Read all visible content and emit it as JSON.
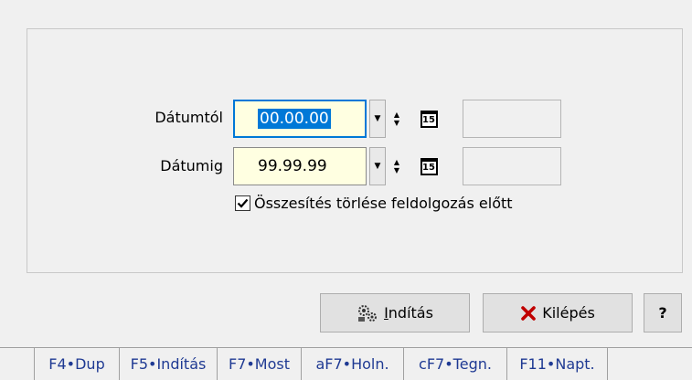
{
  "form": {
    "date_from": {
      "label": "Dátumtól",
      "value": "00.00.00",
      "extra": ""
    },
    "date_to": {
      "label": "Dátumig",
      "value": "99.99.99",
      "extra": ""
    },
    "calendar_icon_text": "15",
    "checkbox": {
      "label": "Összesítés törlése feldolgozás előtt",
      "checked": true
    }
  },
  "buttons": {
    "start_prefix": "",
    "start_underline": "I",
    "start_rest": "ndítás",
    "exit_label": "Kilépés",
    "help_label": "?"
  },
  "function_keys": [
    {
      "label": "F4•Dup"
    },
    {
      "label": "F5•Indítás"
    },
    {
      "label": "F7•Most"
    },
    {
      "label": "aF7•Holn."
    },
    {
      "label": "cF7•Tegn."
    },
    {
      "label": "F11•Napt."
    }
  ],
  "colors": {
    "input_bg": "#ffffe1",
    "focus_border": "#0078d7",
    "fkey_text": "#1f3a93",
    "exit_x": "#c00000"
  },
  "icons": {
    "dropdown": "chevron-down-icon",
    "spin": "spinner-icon",
    "calendar": "calendar-icon",
    "start": "gears-icon",
    "exit": "close-x-icon",
    "check": "checkmark-icon"
  }
}
